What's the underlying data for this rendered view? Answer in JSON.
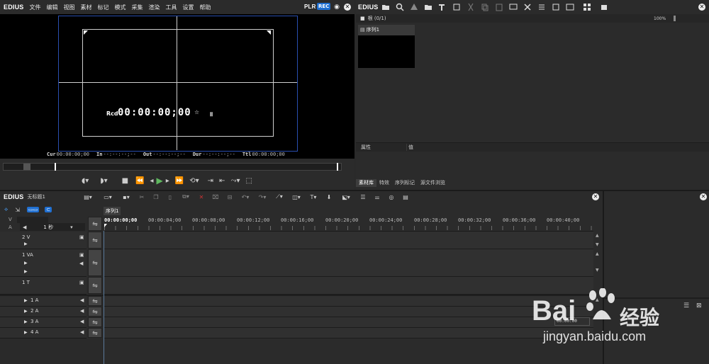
{
  "app": {
    "brand": "EDIUS"
  },
  "menu": [
    "文件",
    "编辑",
    "视图",
    "素材",
    "标记",
    "模式",
    "采集",
    "渲染",
    "工具",
    "设置",
    "帮助"
  ],
  "player": {
    "mode_plr": "PLR",
    "mode_rec": "REC",
    "rcd_label": "Rcd",
    "rcd_timecode": "00:00:00;00",
    "pause_glyph": "॥",
    "cur_label": "Cur",
    "cur_value": "00:00:00;00",
    "in_label": "In",
    "in_value": "--:--:--;--",
    "out_label": "Out",
    "out_value": "--:--:--;--",
    "dur_label": "Dur",
    "dur_value": "--:--:--;--",
    "ttl_label": "Ttl",
    "ttl_value": "00:00:00;00"
  },
  "bin": {
    "folder_label": "根 (0/1)",
    "zoom": "100%",
    "clip_name": "序列1",
    "prop_col1": "属性",
    "prop_col2": "值",
    "tabs": [
      "素材库",
      "特效",
      "序列标记",
      "源文件浏览"
    ]
  },
  "timeline": {
    "project_title": "无标题1",
    "seq_tab": "序列1",
    "scale_label": "1 秒",
    "ruler": [
      "00:00:00;00",
      "00:00:04;00",
      "00:00:08;00",
      "00:00:12;00",
      "00:00:16;00",
      "00:00:20;00",
      "00:00:24;00",
      "00:00:28;00",
      "00:00:32;00",
      "00:00:36;00",
      "00:00:40;00"
    ],
    "v_label": "V",
    "a_label": "A",
    "tracks": [
      {
        "name": "2 V"
      },
      {
        "name": "1 VA"
      },
      {
        "name": "1 T"
      },
      {
        "name": "1 A"
      },
      {
        "name": "2 A"
      },
      {
        "name": "3 A"
      },
      {
        "name": "4 A"
      }
    ],
    "overlay_tc": "00:00:00"
  },
  "watermark": {
    "text1": "Bai",
    "text2": "经验",
    "url": "jingyan.baidu.com"
  },
  "colors": {
    "accent_blue": "#1f6fd1",
    "play_green": "#5fb85f",
    "guide_blue": "#2a4fb0"
  }
}
